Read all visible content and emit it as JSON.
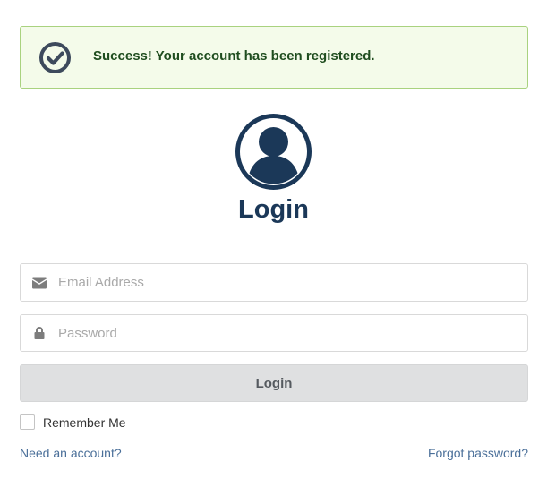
{
  "alert": {
    "message": "Success! Your account has been registered.",
    "icon": "check-circle-icon"
  },
  "avatar": {
    "icon": "user-circle-icon"
  },
  "heading": "Login",
  "form": {
    "email": {
      "placeholder": "Email Address",
      "value": "",
      "icon": "envelope-icon"
    },
    "password": {
      "placeholder": "Password",
      "value": "",
      "icon": "lock-icon"
    },
    "submit_label": "Login",
    "remember_label": "Remember Me",
    "remember_checked": false
  },
  "links": {
    "need_account": "Need an account?",
    "forgot_password": "Forgot password?"
  },
  "colors": {
    "alert_bg": "#f4fbea",
    "alert_border": "#a9d27f",
    "alert_text": "#1f4d1f",
    "brand_navy": "#1b3858",
    "icon_slate": "#3d4a5c",
    "button_bg": "#dfe0e1",
    "link": "#4a6f99"
  }
}
